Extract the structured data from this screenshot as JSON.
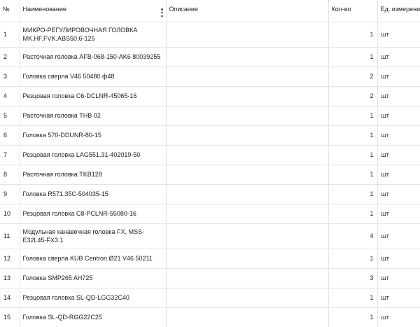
{
  "columns": {
    "num": "№",
    "name": "Наименование",
    "desc": "Описание",
    "qty": "Кол-во",
    "unit": "Ед. измерения"
  },
  "rows": [
    {
      "num": "1",
      "name": "МИКРО-РЕГУЛИРОВОЧНАЯ ГОЛОВКА MK.HF.FVK.ABS50.6-125",
      "desc": "",
      "qty": "1",
      "unit": "шт"
    },
    {
      "num": "2",
      "name": "Расточная головка AFB-068-150-AK6 80039255",
      "desc": "",
      "qty": "1",
      "unit": "шт"
    },
    {
      "num": "3",
      "name": "Головка сверла V46 50480 ф48",
      "desc": "",
      "qty": "2",
      "unit": "шт"
    },
    {
      "num": "4",
      "name": "Резцовая головка C6-DCLNR-45065-16",
      "desc": "",
      "qty": "2",
      "unit": "шт"
    },
    {
      "num": "5",
      "name": "Расточная головка THB 02",
      "desc": "",
      "qty": "1",
      "unit": "шт"
    },
    {
      "num": "6",
      "name": "Головка 570-DDUNR-80-15",
      "desc": "",
      "qty": "1",
      "unit": "шт"
    },
    {
      "num": "7",
      "name": "Резцовая головка LAG551.31-402019-50",
      "desc": "",
      "qty": "1",
      "unit": "шт"
    },
    {
      "num": "8",
      "name": "Расточная головка TKB128",
      "desc": "",
      "qty": "1",
      "unit": "шт"
    },
    {
      "num": "9",
      "name": "Головка R571.35C-504035-15",
      "desc": "",
      "qty": "1",
      "unit": "шт"
    },
    {
      "num": "10",
      "name": "Резцовая головка C8-PCLNR-55080-16",
      "desc": "",
      "qty": "1",
      "unit": "шт"
    },
    {
      "num": "11",
      "name": "Модульная канавочная головка FX, MSS-E32L45-FX3.1",
      "desc": "",
      "qty": "4",
      "unit": "шт"
    },
    {
      "num": "12",
      "name": "Головка сверла KUB Centron Ø21 V46 50211",
      "desc": "",
      "qty": "1",
      "unit": "шт"
    },
    {
      "num": "13",
      "name": "Головка SMP265 AH725",
      "desc": "",
      "qty": "3",
      "unit": "шт"
    },
    {
      "num": "14",
      "name": "Резцовая головка SL-QD-LGG32C40",
      "desc": "",
      "qty": "1",
      "unit": "шт"
    },
    {
      "num": "15",
      "name": "Головка SL-QD-RGG22C25",
      "desc": "",
      "qty": "1",
      "unit": "шт"
    }
  ],
  "icons": {
    "column_menu": "kebab-menu-icon"
  }
}
